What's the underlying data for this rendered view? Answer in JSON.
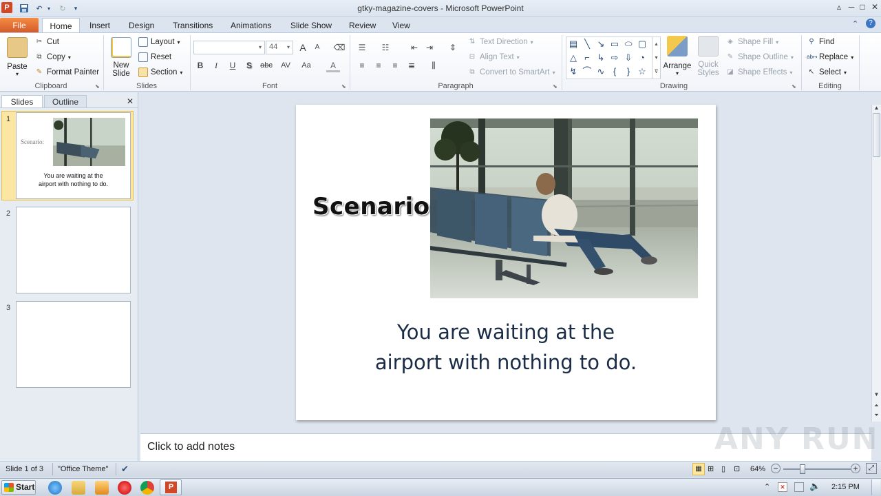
{
  "window": {
    "title": "gtky-magazine-covers - Microsoft PowerPoint",
    "app_icon_letter": "P",
    "minimize": "─",
    "maximize": "□",
    "close": "✕"
  },
  "tabs": [
    "File",
    "Home",
    "Insert",
    "Design",
    "Transitions",
    "Animations",
    "Slide Show",
    "Review",
    "View"
  ],
  "ribbon": {
    "clipboard": {
      "paste": "Paste",
      "cut": "Cut",
      "copy": "Copy",
      "format_painter": "Format Painter",
      "label": "Clipboard"
    },
    "slides": {
      "new_slide_line1": "New",
      "new_slide_line2": "Slide",
      "layout": "Layout",
      "reset": "Reset",
      "section": "Section",
      "label": "Slides"
    },
    "font": {
      "font_name": "",
      "font_size": "44",
      "bold": "B",
      "italic": "I",
      "underline": "U",
      "shadow": "S",
      "strikethrough": "abc",
      "spacing": "AV",
      "case": "Aa",
      "color": "A",
      "grow": "A",
      "shrink": "A",
      "label": "Font"
    },
    "paragraph": {
      "text_direction": "Text Direction",
      "align_text": "Align Text",
      "convert_smartart": "Convert to SmartArt",
      "label": "Paragraph"
    },
    "drawing": {
      "arrange": "Arrange",
      "quick_styles_line1": "Quick",
      "quick_styles_line2": "Styles",
      "shape_fill": "Shape Fill",
      "shape_outline": "Shape Outline",
      "shape_effects": "Shape Effects",
      "label": "Drawing"
    },
    "editing": {
      "find": "Find",
      "replace": "Replace",
      "select": "Select",
      "label": "Editing"
    }
  },
  "left_panel": {
    "tab_slides": "Slides",
    "tab_outline": "Outline",
    "close": "✕",
    "thumbnails": [
      {
        "num": "1",
        "title": "Scenario:",
        "body_line1": "You are waiting at the",
        "body_line2": "airport with nothing to do."
      },
      {
        "num": "2"
      },
      {
        "num": "3"
      }
    ]
  },
  "slide": {
    "title": "Scenario:",
    "body_line1": "You are waiting at the",
    "body_line2": "airport with nothing to do."
  },
  "notes_placeholder": "Click to add notes",
  "status": {
    "slide_of": "Slide 1 of 3",
    "theme": "\"Office Theme\"",
    "zoom": "64%"
  },
  "taskbar": {
    "start": "Start",
    "clock": "2:15 PM"
  },
  "watermark": "ANY RUN"
}
